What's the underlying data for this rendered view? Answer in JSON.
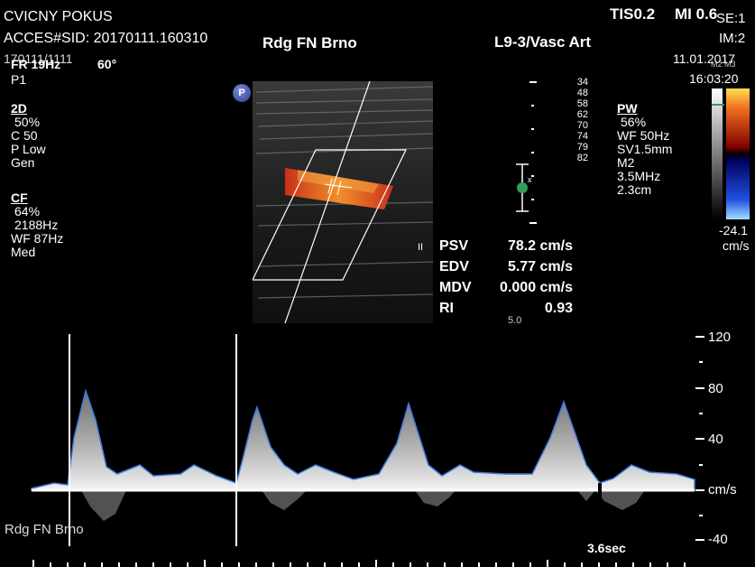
{
  "header": {
    "patient_name": "CVICNY POKUS",
    "access_id": "ACCES#SID: 20170111.160310",
    "id_line": "170111/1111",
    "institution": "Rdg FN Brno",
    "probe_preset": "L9-3/Vasc Art",
    "tis": "TIS0.2",
    "mi": "MI 0.6",
    "se": "SE:1",
    "im": "IM:2",
    "date": "11.01.2017",
    "time": "16:03:20",
    "fr": "FR 19Hz",
    "angle": "60°",
    "p1": "P1",
    "m2_label": "M2 M3"
  },
  "params_2d": {
    "title": "2D",
    "lines": [
      "50%",
      "C 50",
      "P Low",
      "Gen"
    ]
  },
  "params_cf": {
    "title": "CF",
    "lines": [
      "64%",
      "2188Hz",
      "WF  87Hz",
      "Med"
    ]
  },
  "params_pw": {
    "title": "PW",
    "lines": [
      "56%",
      "WF  50Hz",
      "SV1.5mm",
      "M2",
      "3.5MHz",
      "2.3cm"
    ]
  },
  "depth_scale": [
    "34",
    "48",
    "58",
    "62",
    "70",
    "74",
    "79",
    "82"
  ],
  "color_bar": {
    "bottom_value": "-24.1",
    "unit": "cm/s"
  },
  "measurements": {
    "marker": "II",
    "rows": [
      {
        "label": "PSV",
        "value": "78.2 cm/s"
      },
      {
        "label": "EDV",
        "value": "5.77 cm/s"
      },
      {
        "label": "MDV",
        "value": "0.000 cm/s"
      },
      {
        "label": "RI",
        "value": "0.93"
      }
    ],
    "depth_fragment": "5.0"
  },
  "spectral": {
    "velocity_ticks": [
      "120",
      "80",
      "40",
      "cm/s",
      "-40"
    ],
    "time_label": "3.6sec",
    "footer_institution": "Rdg FN Brno"
  },
  "icons": {
    "p_marker": "P"
  },
  "colors": {
    "doppler_trace": "#3d7be0",
    "flow_red": "#d8381c",
    "flow_orange": "#f08a20",
    "sv_marker": "#2fa05a"
  }
}
